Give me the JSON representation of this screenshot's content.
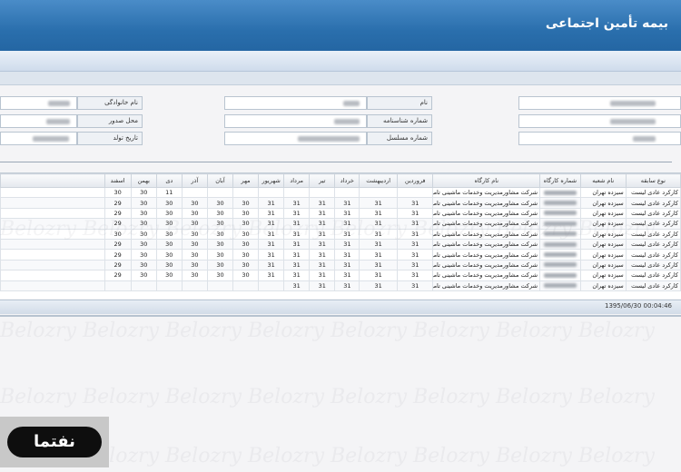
{
  "header": {
    "title": "بیمه تأمین اجتماعی"
  },
  "form": {
    "last_name_label": "نام خانوادگی",
    "issue_place_label": "محل صدور",
    "birth_date_label": "تاریخ تولد",
    "first_name_label": "نام",
    "id_number_label": "شماره شناسنامه",
    "serial_number_label": "شماره مسلسل"
  },
  "grid": {
    "columns": [
      "نوع سابقه",
      "نام شعبه",
      "شماره کارگاه",
      "نام کارگاه",
      "فروردین",
      "اردیبهشت",
      "خرداد",
      "تیر",
      "مرداد",
      "شهریور",
      "مهر",
      "آبان",
      "آذر",
      "دی",
      "بهمن",
      "اسفند"
    ],
    "rows": [
      [
        "کارکرد عادی لیست",
        "سیزده تهران",
        "",
        "شرکت مشاورمدیریت وخدمات ماشینی تامین",
        "",
        "",
        "",
        "",
        "",
        "",
        "",
        "",
        "",
        "11",
        "30",
        "30"
      ],
      [
        "کارکرد عادی لیست",
        "سیزده تهران",
        "",
        "شرکت مشاورمدیریت وخدمات ماشینی تامین",
        "31",
        "31",
        "31",
        "31",
        "31",
        "31",
        "30",
        "30",
        "30",
        "30",
        "30",
        "29"
      ],
      [
        "کارکرد عادی لیست",
        "سیزده تهران",
        "",
        "شرکت مشاورمدیریت وخدمات ماشینی تامین",
        "31",
        "31",
        "31",
        "31",
        "31",
        "31",
        "30",
        "30",
        "30",
        "30",
        "30",
        "29"
      ],
      [
        "کارکرد عادی لیست",
        "سیزده تهران",
        "",
        "شرکت مشاورمدیریت وخدمات ماشینی تامین",
        "31",
        "31",
        "31",
        "31",
        "31",
        "31",
        "30",
        "30",
        "30",
        "30",
        "30",
        "29"
      ],
      [
        "کارکرد عادی لیست",
        "سیزده تهران",
        "",
        "شرکت مشاورمدیریت وخدمات ماشینی تامین",
        "31",
        "31",
        "31",
        "31",
        "31",
        "31",
        "30",
        "30",
        "30",
        "30",
        "30",
        "30"
      ],
      [
        "کارکرد عادی لیست",
        "سیزده تهران",
        "",
        "شرکت مشاورمدیریت وخدمات ماشینی تامین",
        "31",
        "31",
        "31",
        "31",
        "31",
        "31",
        "30",
        "30",
        "30",
        "30",
        "30",
        "29"
      ],
      [
        "کارکرد عادی لیست",
        "سیزده تهران",
        "",
        "شرکت مشاورمدیریت وخدمات ماشینی تامین",
        "31",
        "31",
        "31",
        "31",
        "31",
        "31",
        "30",
        "30",
        "30",
        "30",
        "30",
        "29"
      ],
      [
        "کارکرد عادی لیست",
        "سیزده تهران",
        "",
        "شرکت مشاورمدیریت وخدمات ماشینی تامین",
        "31",
        "31",
        "31",
        "31",
        "31",
        "31",
        "30",
        "30",
        "30",
        "30",
        "30",
        "29"
      ],
      [
        "کارکرد عادی لیست",
        "سیزده تهران",
        "",
        "شرکت مشاورمدیریت وخدمات ماشینی تامین",
        "31",
        "31",
        "31",
        "31",
        "31",
        "31",
        "30",
        "30",
        "30",
        "30",
        "30",
        "29"
      ],
      [
        "کارکرد عادی لیست",
        "سیزده تهران",
        "",
        "شرکت مشاورمدیریت وخدمات ماشینی تامین",
        "31",
        "31",
        "31",
        "31",
        "31",
        "",
        "",
        "",
        "",
        "",
        "",
        ""
      ]
    ]
  },
  "status": {
    "timestamp": "1395/06/30 00:04:46"
  },
  "logo": {
    "text": "نفتما"
  },
  "colors": {
    "banner": "#2a6fad",
    "header_bg": "#e4e8ee"
  }
}
